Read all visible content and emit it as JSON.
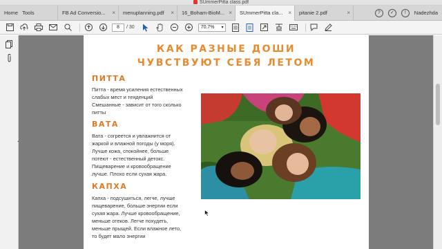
{
  "window": {
    "title": "SUmmerPitta class.pdf"
  },
  "tabs": [
    {
      "label": "Home",
      "extra": "Tools",
      "active": false
    },
    {
      "label": "FB Ad Conversio...",
      "active": false
    },
    {
      "label": "menuplanning.pdf",
      "active": false
    },
    {
      "label": "16_Boham-BioM...",
      "active": false
    },
    {
      "label": "SUmmerPitta cla...",
      "active": true
    },
    {
      "label": "pitanie 2.pdf",
      "active": false
    }
  ],
  "tab_close_glyph": "×",
  "user": {
    "name": "Nadezhda"
  },
  "toolbar": {
    "page_current": "8",
    "page_total": "/ 30",
    "zoom": "70.7%"
  },
  "document": {
    "title_line1": "КАК РАЗНЫЕ ДОШИ",
    "title_line2": "ЧУВСТВУЮТ СЕБЯ ЛЕТОМ",
    "sections": [
      {
        "heading": "ПИТТА",
        "lines": [
          "Питта - время усиления естественных",
          "слабых мест и тенденций",
          "Смешанные - зависит от того сколько",
          "питты"
        ]
      },
      {
        "heading": "ВАТА",
        "lines": [
          "Вата - согреется и увлажнится от",
          "жаркой и влажной погоды (у моря).",
          "Лучше кожа, спокойнее, больше",
          "потеют - естественный детокс.",
          "Пищеварение и кровообращение",
          "лучше. Плохо если сухая жара."
        ]
      },
      {
        "heading": "КАПХА",
        "lines": [
          "Капха - подсушиться, легче, лучше",
          "пищеварение, больше энергии если",
          "сухая жара. Лучше кровообращение,",
          "меньше отеков. Легче похудеть,",
          "меньше прыщей. Если влажное лето,",
          "то будет мало энергии"
        ]
      }
    ]
  },
  "colors": {
    "accent_orange": "#e98a2e",
    "doc_background": "#7c7c7c"
  }
}
